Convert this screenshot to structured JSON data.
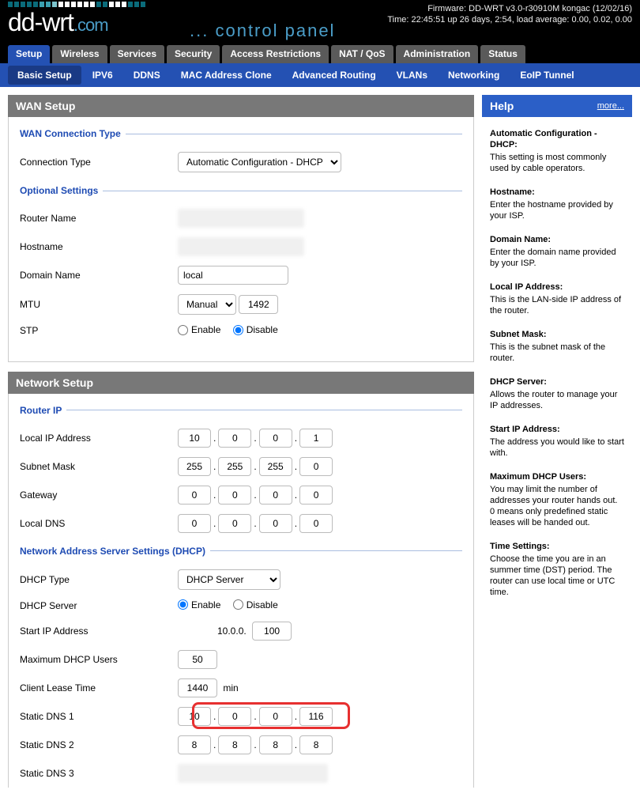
{
  "header": {
    "firmware": "Firmware: DD-WRT v3.0-r30910M kongac (12/02/16)",
    "time": "Time: 22:45:51 up 26 days, 2:54, load average: 0.00, 0.02, 0.00",
    "cp": "control panel"
  },
  "tabs": [
    "Setup",
    "Wireless",
    "Services",
    "Security",
    "Access Restrictions",
    "NAT / QoS",
    "Administration",
    "Status"
  ],
  "activeTab": 0,
  "subtabs": [
    "Basic Setup",
    "IPV6",
    "DDNS",
    "MAC Address Clone",
    "Advanced Routing",
    "VLANs",
    "Networking",
    "EoIP Tunnel"
  ],
  "activeSubtab": 0,
  "wan": {
    "title": "WAN Setup",
    "conn_type": {
      "legend": "WAN Connection Type",
      "label": "Connection Type",
      "value": "Automatic Configuration - DHCP"
    },
    "optional": {
      "legend": "Optional Settings",
      "router_name": "Router Name",
      "hostname": "Hostname",
      "domain_label": "Domain Name",
      "domain_value": "local",
      "mtu_label": "MTU",
      "mtu_mode": "Manual",
      "mtu_value": "1492",
      "stp_label": "STP",
      "enable": "Enable",
      "disable": "Disable"
    }
  },
  "net": {
    "title": "Network Setup",
    "router_ip": {
      "legend": "Router IP",
      "localip_label": "Local IP Address",
      "localip": [
        "10",
        "0",
        "0",
        "1"
      ],
      "subnet_label": "Subnet Mask",
      "subnet": [
        "255",
        "255",
        "255",
        "0"
      ],
      "gateway_label": "Gateway",
      "gateway": [
        "0",
        "0",
        "0",
        "0"
      ],
      "localdns_label": "Local DNS",
      "localdns": [
        "0",
        "0",
        "0",
        "0"
      ]
    },
    "dhcp": {
      "legend": "Network Address Server Settings (DHCP)",
      "type_label": "DHCP Type",
      "type_value": "DHCP Server",
      "server_label": "DHCP Server",
      "enable": "Enable",
      "disable": "Disable",
      "startip_label": "Start IP Address",
      "startip_prefix": "10.0.0.",
      "startip": "100",
      "max_label": "Maximum DHCP Users",
      "max": "50",
      "lease_label": "Client Lease Time",
      "lease": "1440",
      "lease_unit": "min",
      "dns1_label": "Static DNS 1",
      "dns1": [
        "10",
        "0",
        "0",
        "116"
      ],
      "dns2_label": "Static DNS 2",
      "dns2": [
        "8",
        "8",
        "8",
        "8"
      ],
      "dns3_label": "Static DNS 3"
    }
  },
  "help": {
    "title": "Help",
    "more": "more...",
    "items": [
      {
        "t": "Automatic Configuration - DHCP:",
        "b": "This setting is most commonly used by cable operators."
      },
      {
        "t": "Hostname:",
        "b": "Enter the hostname provided by your ISP."
      },
      {
        "t": "Domain Name:",
        "b": "Enter the domain name provided by your ISP."
      },
      {
        "t": "Local IP Address:",
        "b": "This is the LAN-side IP address of the router."
      },
      {
        "t": "Subnet Mask:",
        "b": "This is the subnet mask of the router."
      },
      {
        "t": "DHCP Server:",
        "b": "Allows the router to manage your IP addresses."
      },
      {
        "t": "Start IP Address:",
        "b": "The address you would like to start with."
      },
      {
        "t": "Maximum DHCP Users:",
        "b": "You may limit the number of addresses your router hands out. 0 means only predefined static leases will be handed out."
      },
      {
        "t": "Time Settings:",
        "b": "Choose the time you are in an summer time (DST) period. The router can use local time or UTC time."
      }
    ]
  },
  "bars": [
    "#0a6b7a",
    "#0a6b7a",
    "#0a6b7a",
    "#0a6b7a",
    "#0a6b7a",
    "#3aa0b0",
    "#3aa0b0",
    "#7cc4cd",
    "#fff",
    "#fff",
    "#fff",
    "#fff",
    "#fff",
    "#fff",
    "#0a6b7a",
    "#0a6b7a",
    "#fff",
    "#fff",
    "#fff",
    "#0a6b7a",
    "#0a6b7a",
    "#0a6b7a"
  ]
}
